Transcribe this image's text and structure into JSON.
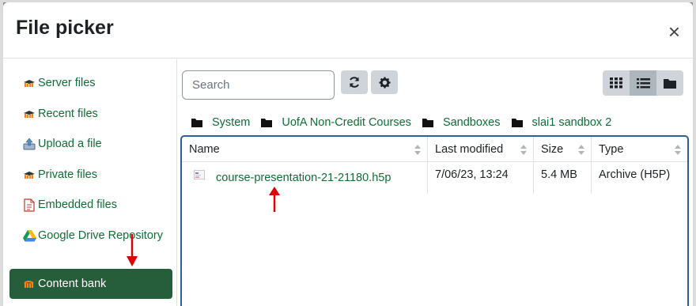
{
  "dialog": {
    "title": "File picker",
    "close_glyph": "×"
  },
  "sidebar": {
    "items": [
      {
        "label": "Server files",
        "icon": "moodle-icon"
      },
      {
        "label": "Recent files",
        "icon": "moodle-icon"
      },
      {
        "label": "Upload a file",
        "icon": "upload-icon"
      },
      {
        "label": "Private files",
        "icon": "moodle-icon"
      },
      {
        "label": "Embedded files",
        "icon": "embedded-file-icon"
      },
      {
        "label": "Google Drive Repository",
        "icon": "google-drive-icon"
      },
      {
        "label": "Content bank",
        "icon": "moodle-icon",
        "active": true
      }
    ]
  },
  "toolbar": {
    "search_placeholder": "Search",
    "refresh_icon": "refresh-icon",
    "settings_icon": "gear-icon",
    "views": [
      "grid-view-icon",
      "list-view-icon",
      "folder-view-icon"
    ],
    "selected_view": "list-view-icon"
  },
  "breadcrumb": [
    "System",
    "UofA Non-Credit Courses",
    "Sandboxes",
    "slai1 sandbox 2"
  ],
  "table": {
    "columns": [
      "Name",
      "Last modified",
      "Size",
      "Type"
    ],
    "rows": [
      {
        "name": "course-presentation-21-21180.h5p",
        "modified": "7/06/23, 13:24",
        "size": "5.4 MB",
        "type": "Archive (H5P)"
      }
    ]
  },
  "colors": {
    "link": "#0f6e36",
    "active_bg": "#265d3a",
    "annotation_arrow": "#e00000",
    "file_table_border": "#2e5f9c"
  }
}
